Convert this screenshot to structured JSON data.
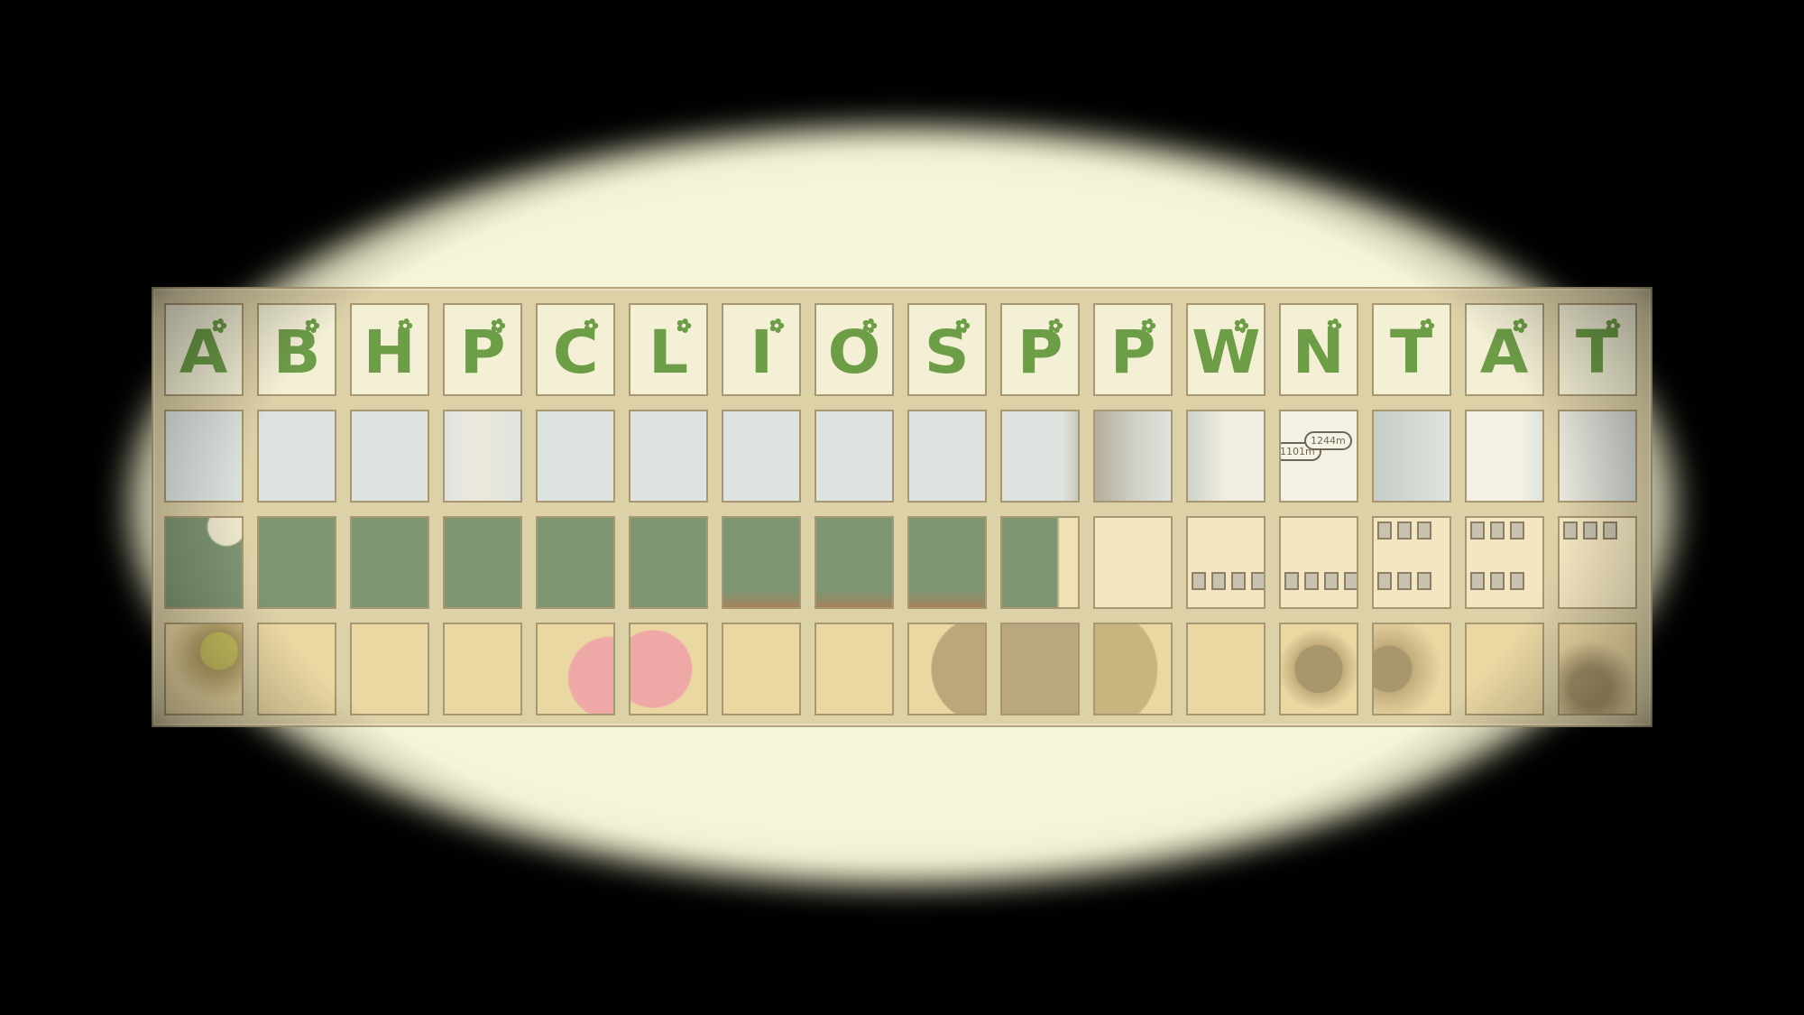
{
  "puzzle": {
    "letters": [
      "A",
      "B",
      "H",
      "P",
      "C",
      "L",
      "I",
      "O",
      "S",
      "P",
      "P",
      "W",
      "N",
      "T",
      "A",
      "T"
    ],
    "map_labels": [
      "1101m",
      "1244m"
    ],
    "colors": {
      "letter_green": "#6e9d48",
      "board_green": "#7f9673",
      "backdrop": "#f6f5da",
      "frame": "#ddd1a8"
    }
  }
}
